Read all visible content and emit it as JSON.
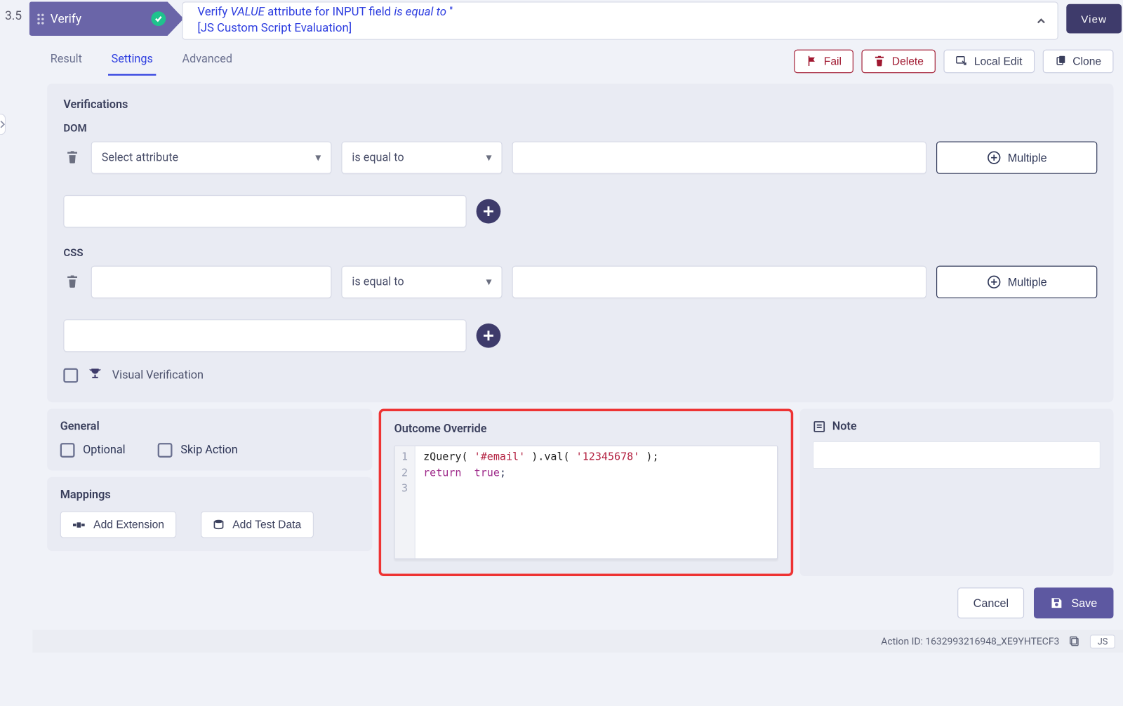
{
  "step_number": "3.5",
  "verify_chip_label": "Verify",
  "title_line1": {
    "verify": "Verify ",
    "value": "VALUE",
    "attr_for": "  attribute for ",
    "input": "INPUT",
    "field": "  field ",
    "eq": "is equal to ",
    "quote": "''"
  },
  "title_line2": "[JS Custom Script Evaluation]",
  "view_btn": "View",
  "tabs": {
    "result": "Result",
    "settings": "Settings",
    "advanced": "Advanced"
  },
  "toolbar": {
    "fail": "Fail",
    "delete": "Delete",
    "local_edit": "Local Edit",
    "clone": "Clone"
  },
  "verifications": {
    "title": "Verifications",
    "dom_label": "DOM",
    "css_label": "CSS",
    "select_attr_placeholder": "Select attribute",
    "op_equal": "is equal to",
    "multiple": "Multiple",
    "visual_verification": "Visual Verification"
  },
  "general": {
    "title": "General",
    "optional": "Optional",
    "skip": "Skip Action"
  },
  "mappings": {
    "title": "Mappings",
    "add_ext": "Add Extension",
    "add_data": "Add Test Data"
  },
  "override": {
    "title": "Outcome Override",
    "code": {
      "l1": {
        "a": "zQuery( ",
        "b": "'#email'",
        "c": " ).val( ",
        "d": "'12345678'",
        "e": " );"
      },
      "l2": {
        "a": "return",
        "b": "  ",
        "c": "true",
        "d": ";"
      }
    }
  },
  "note": {
    "title": "Note"
  },
  "footer": {
    "cancel": "Cancel",
    "save": "Save"
  },
  "status": {
    "action_id_label": "Action ID: ",
    "action_id": "1632993216948_XE9YHTECF3",
    "js": "JS"
  }
}
